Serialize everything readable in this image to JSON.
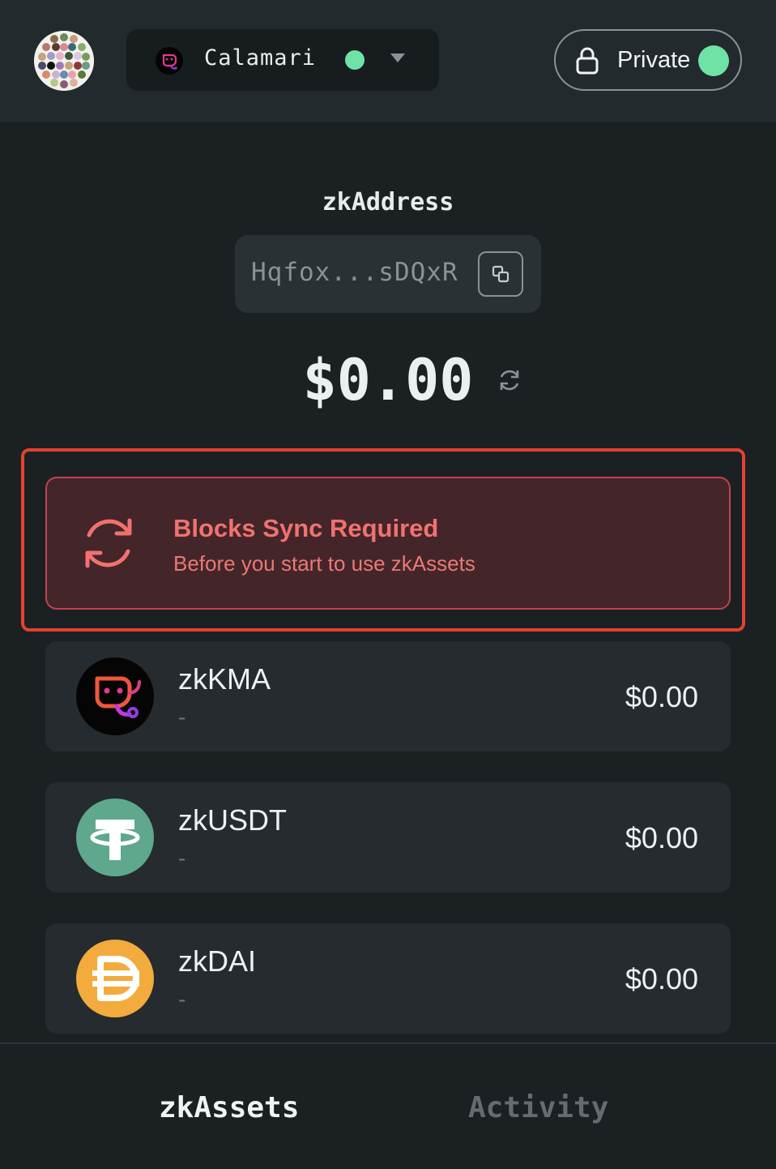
{
  "header": {
    "network": {
      "name": "Calamari",
      "status_color": "#6fe3a5"
    },
    "mode_toggle": {
      "label": "Private",
      "state": "on"
    }
  },
  "account": {
    "address_label": "zkAddress",
    "address_short": "Hqfox...sDQxR",
    "total_balance": "$0.00"
  },
  "sync_notice": {
    "title": "Blocks Sync Required",
    "subtitle": "Before you start to use zkAssets"
  },
  "assets": [
    {
      "symbol": "zkKMA",
      "amount": "-",
      "value": "$0.00",
      "icon": "kma-logo-icon"
    },
    {
      "symbol": "zkUSDT",
      "amount": "-",
      "value": "$0.00",
      "icon": "usdt-logo-icon"
    },
    {
      "symbol": "zkDAI",
      "amount": "-",
      "value": "$0.00",
      "icon": "dai-logo-icon"
    }
  ],
  "tabs": [
    {
      "label": "zkAssets",
      "active": true
    },
    {
      "label": "Activity",
      "active": false
    }
  ],
  "colors": {
    "accent_green": "#6fe3a5",
    "warning_red": "#f0726f",
    "highlight_border": "#e4412f"
  }
}
